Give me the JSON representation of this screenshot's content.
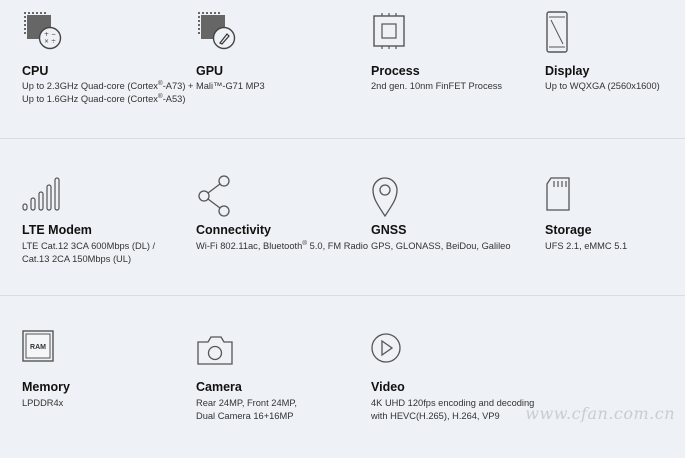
{
  "specs": {
    "cpu": {
      "icon": "cpu-chip-icon",
      "title": "CPU",
      "line1_a": "Up to 2.3GHz Quad-core (Cortex",
      "line1_sup": "®",
      "line1_b": "-A73) +",
      "line2_a": "Up to 1.6GHz Quad-core (Cortex",
      "line2_sup": "®",
      "line2_b": "-A53)",
      "chip_glyphs": "+ −\n× ÷"
    },
    "gpu": {
      "icon": "gpu-chip-icon",
      "title": "GPU",
      "line1": "Mali™-G71 MP3"
    },
    "process": {
      "icon": "process-chip-icon",
      "title": "Process",
      "line1": "2nd gen. 10nm FinFET Process"
    },
    "display": {
      "icon": "phone-display-icon",
      "title": "Display",
      "line1": "Up to WQXGA (2560x1600)"
    },
    "lte": {
      "icon": "signal-bars-icon",
      "title": "LTE Modem",
      "line1": "LTE Cat.12 3CA 600Mbps (DL) /",
      "line2": "Cat.13 2CA 150Mbps (UL)"
    },
    "connectivity": {
      "icon": "share-nodes-icon",
      "title": "Connectivity",
      "line1_a": "Wi-Fi 802.11ac, Bluetooth",
      "line1_sup": "®",
      "line1_b": " 5.0, FM Radio"
    },
    "gnss": {
      "icon": "location-pin-icon",
      "title": "GNSS",
      "line1": "GPS, GLONASS, BeiDou, Galileo"
    },
    "storage": {
      "icon": "sd-card-icon",
      "title": "Storage",
      "line1": "UFS 2.1, eMMC 5.1"
    },
    "memory": {
      "icon": "ram-chip-icon",
      "title": "Memory",
      "line1": "LPDDR4x",
      "chip_label": "RAM"
    },
    "camera": {
      "icon": "camera-icon",
      "title": "Camera",
      "line1": "Rear 24MP, Front 24MP,",
      "line2": "Dual Camera 16+16MP"
    },
    "video": {
      "icon": "play-circle-icon",
      "title": "Video",
      "line1": "4K UHD 120fps encoding and decoding",
      "line2": "with HEVC(H.265), H.264, VP9"
    }
  },
  "watermark": "www.cfan.com.cn",
  "colors": {
    "background": "#eef1f5",
    "icon": "#555555",
    "text": "#1a1a1a",
    "divider": "#d8dde3"
  }
}
